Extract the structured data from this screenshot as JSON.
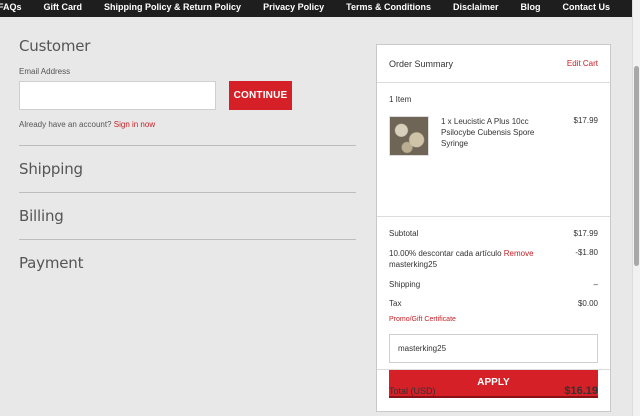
{
  "nav": [
    "FAQs",
    "Gift Card",
    "Shipping Policy & Return Policy",
    "Privacy Policy",
    "Terms & Conditions",
    "Disclaimer",
    "Blog",
    "Contact Us"
  ],
  "customer": {
    "title": "Customer",
    "email_label": "Email Address",
    "email_value": "",
    "continue_label": "CONTINUE",
    "signin_prompt": "Already have an account?",
    "signin_link": "Sign in now"
  },
  "sections": [
    "Shipping",
    "Billing",
    "Payment"
  ],
  "summary": {
    "title": "Order Summary",
    "edit_cart": "Edit Cart",
    "item_count": "1 Item",
    "item_name": "1 x Leucistic A Plus 10cc Psilocybe Cubensis Spore Syringe",
    "item_price": "$17.99",
    "subtotal_label": "Subtotal",
    "subtotal_value": "$17.99",
    "discount_label": "10.00% descontar cada artículo",
    "discount_remove": "Remove",
    "discount_code": "masterking25",
    "discount_value": "-$1.80",
    "shipping_label": "Shipping",
    "shipping_value": "–",
    "tax_label": "Tax",
    "tax_value": "$0.00",
    "promo_label": "Promo/Gift Certificate",
    "promo_value": "masterking25",
    "apply_label": "APPLY",
    "total_label": "Total (USD)",
    "total_value": "$16.19"
  },
  "colors": {
    "accent": "#d42026",
    "nav_bg": "#1e1e1e",
    "page_bg": "#e8e8e8"
  }
}
